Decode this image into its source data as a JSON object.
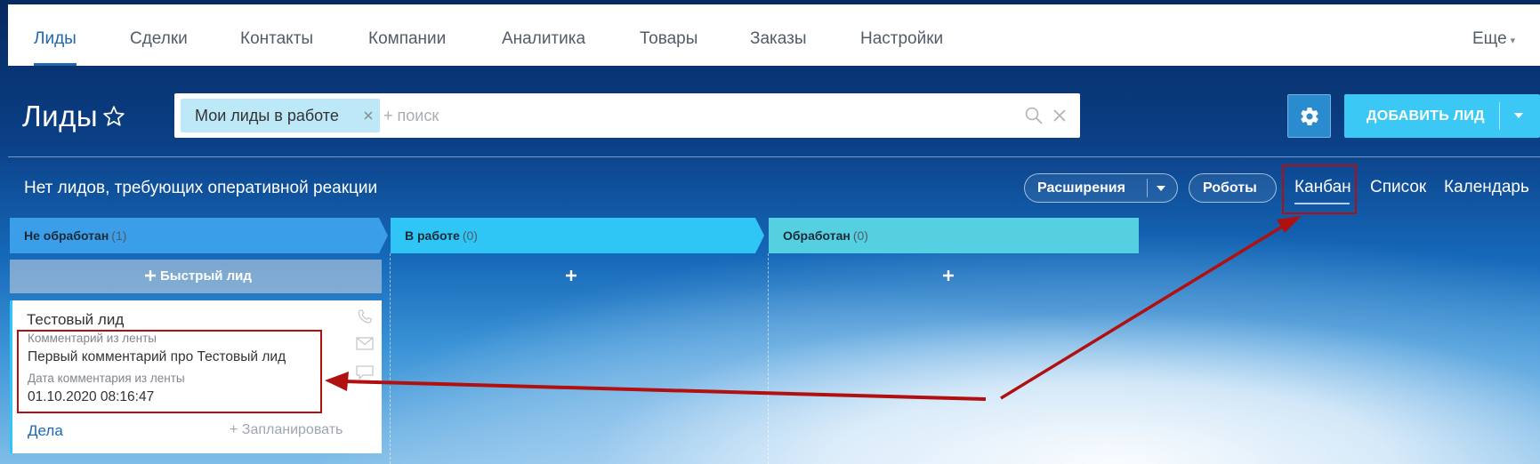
{
  "nav": {
    "items": [
      "Лиды",
      "Сделки",
      "Контакты",
      "Компании",
      "Аналитика",
      "Товары",
      "Заказы",
      "Настройки"
    ],
    "more_label": "Еще"
  },
  "header": {
    "title": "Лиды",
    "filter_chip": "Мои лиды в работе",
    "search_placeholder": "+ поиск",
    "add_button": "ДОБАВИТЬ ЛИД"
  },
  "toolbar": {
    "status_message": "Нет лидов, требующих оперативной реакции",
    "extensions_label": "Расширения",
    "robots_label": "Роботы",
    "views": [
      "Канбан",
      "Список",
      "Календарь"
    ],
    "active_view": "Канбан"
  },
  "kanban": {
    "columns": [
      {
        "title": "Не обработан",
        "count": "(1)",
        "color": "#3a9ee8"
      },
      {
        "title": "В работе",
        "count": "(0)",
        "color": "#2fc6f6"
      },
      {
        "title": "Обработан",
        "count": "(0)",
        "color": "#55d0e0"
      }
    ],
    "quick_add_label": "Быстрый лид",
    "card": {
      "title": "Тестовый лид",
      "field1_label": "Комментарий из ленты",
      "field1_value": "Первый комментарий про Тестовый лид",
      "field2_label": "Дата комментария из ленты",
      "field2_value": "01.10.2020 08:16:47",
      "deals_link": "Дела",
      "plan_link": "+ Запланировать"
    }
  },
  "colors": {
    "accent": "#2067b0",
    "add_button": "#3bc8f5",
    "annotation": "#b01010"
  }
}
